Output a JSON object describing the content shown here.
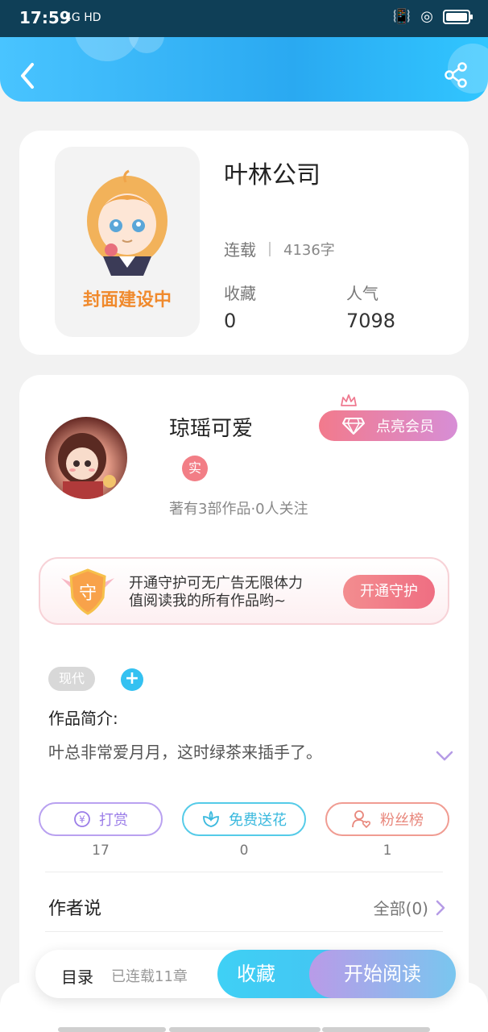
{
  "status_bar": {
    "time": "17:59",
    "network": "4G HD"
  },
  "header": {
    "back_icon": "chevron-left-icon",
    "share_icon": "share-icon",
    "accent": "#3fb7f6"
  },
  "book": {
    "title": "叶林公司",
    "cover_placeholder": "封面建设中",
    "status": "连载",
    "word_count": "4136字",
    "favorites_label": "收藏",
    "favorites_value": "0",
    "popularity_label": "人气",
    "popularity_value": "7098"
  },
  "author": {
    "name": "琼瑶可爱",
    "verified_badge": "实",
    "stats": "著有3部作品·0人关注",
    "vip_button": "点亮会员"
  },
  "guard": {
    "shield_char": "守",
    "line1": "开通守护可无广告无限体力",
    "line2": "值阅读我的所有作品哟~",
    "button": "开通守护"
  },
  "tags": {
    "tag1": "现代",
    "add": "+"
  },
  "intro": {
    "title": "作品简介:",
    "text": "叶总非常爱月月，这时绿茶来插手了。"
  },
  "actions": [
    {
      "label": "打赏",
      "count": "17",
      "icon": "yen-coin-icon",
      "color": "#9b7de8"
    },
    {
      "label": "免费送花",
      "count": "0",
      "icon": "flower-icon",
      "color": "#3ab9de"
    },
    {
      "label": "粉丝榜",
      "count": "1",
      "icon": "user-heart-icon",
      "color": "#e8877c"
    }
  ],
  "author_says": {
    "title": "作者说",
    "all_link": "全部(0)"
  },
  "bottom_bar": {
    "toc_label": "目录",
    "toc_count": "已连载11章",
    "favorite_button": "收藏",
    "read_button": "开始阅读"
  }
}
